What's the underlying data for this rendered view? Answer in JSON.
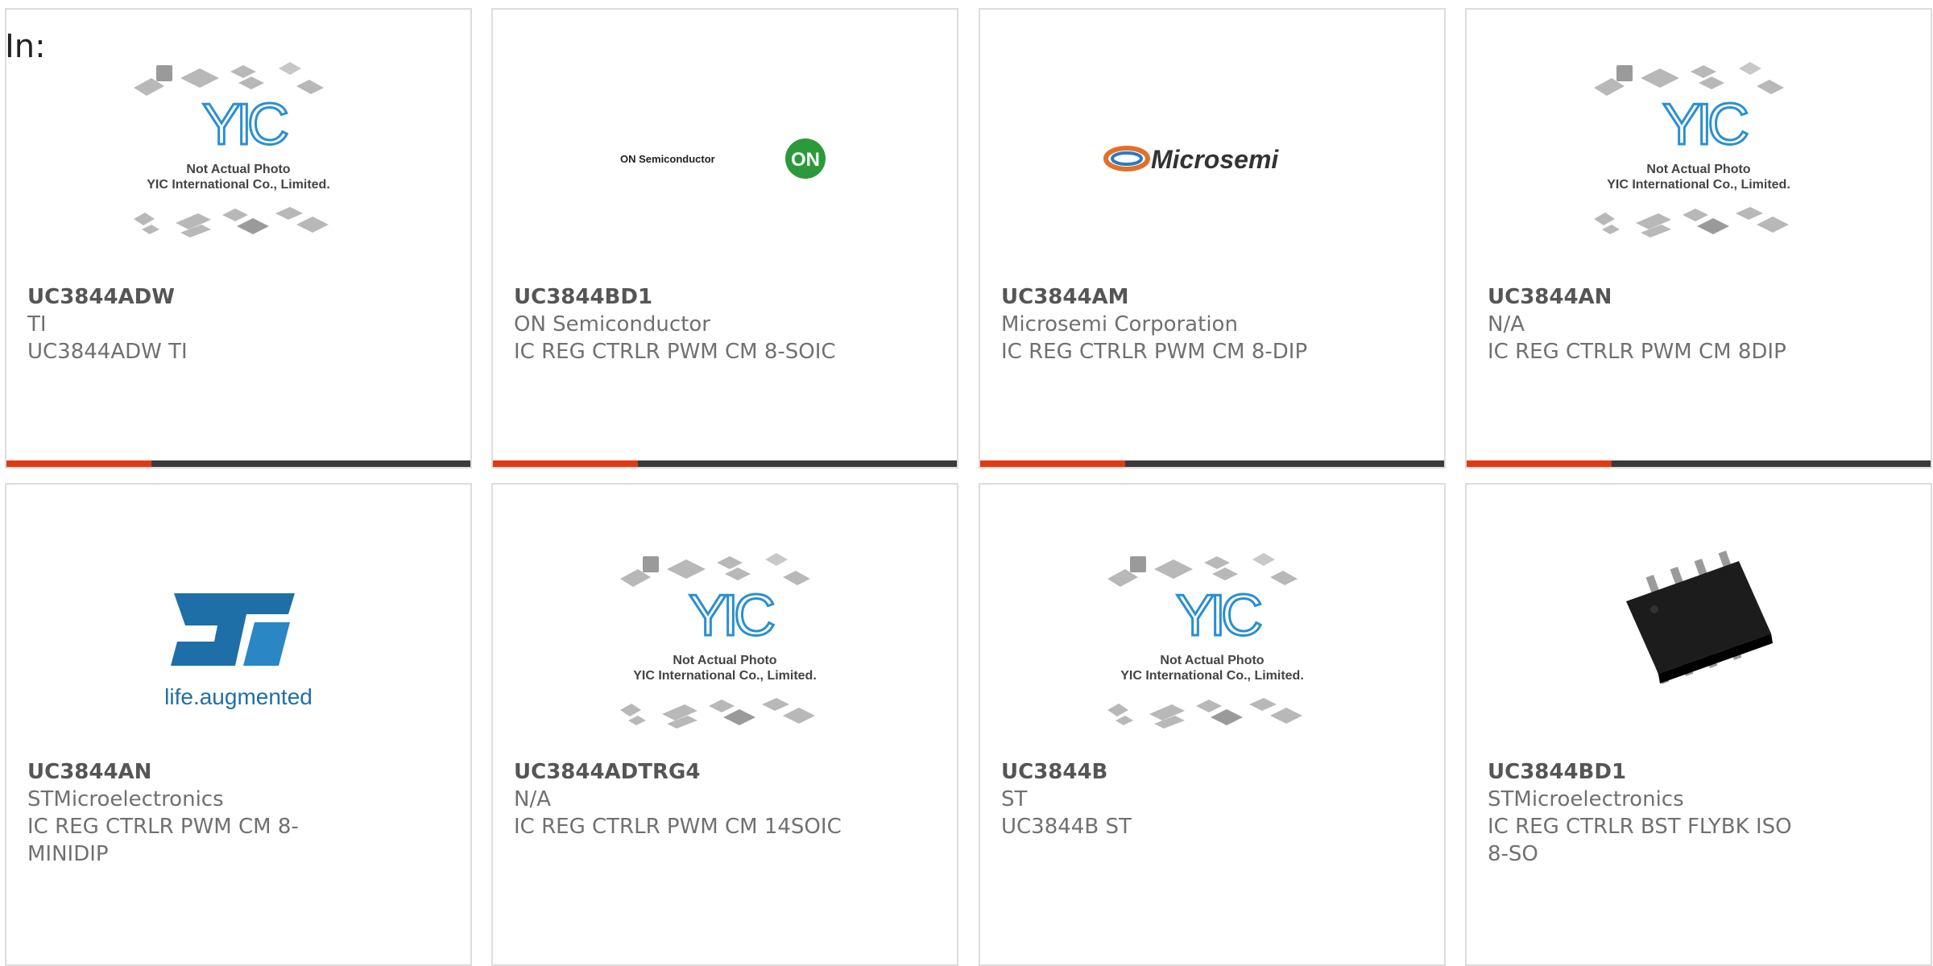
{
  "heading": "In:",
  "placeholder": {
    "line1": "Not Actual Photo",
    "line2": "YIC International Co., Limited.",
    "logo": "YIC"
  },
  "logos": {
    "on": "ON Semiconductor",
    "on_badge": "ON",
    "microsemi": "Microsemi",
    "st_tag": "life.augmented"
  },
  "colors": {
    "accent": "#e03a12",
    "bar": "#3a3a3a",
    "text": "#707070"
  },
  "products": [
    {
      "part": "UC3844ADW",
      "maker": "TI",
      "desc": "UC3844ADW TI",
      "image": "yic-placeholder"
    },
    {
      "part": "UC3844BD1",
      "maker": "ON Semiconductor",
      "desc": "IC REG CTRLR PWM CM 8-SOIC",
      "image": "on-semiconductor-logo"
    },
    {
      "part": "UC3844AM",
      "maker": "Microsemi Corporation",
      "desc": "IC REG CTRLR PWM CM 8-DIP",
      "image": "microsemi-logo"
    },
    {
      "part": "UC3844AN",
      "maker": "N/A",
      "desc": "IC REG CTRLR PWM CM 8DIP",
      "image": "yic-placeholder"
    },
    {
      "part": "UC3844AN",
      "maker": "STMicroelectronics",
      "desc": "IC REG CTRLR PWM CM 8-MINIDIP",
      "image": "st-logo"
    },
    {
      "part": "UC3844ADTRG4",
      "maker": "N/A",
      "desc": "IC REG CTRLR PWM CM 14SOIC",
      "image": "yic-placeholder"
    },
    {
      "part": "UC3844B",
      "maker": "ST",
      "desc": "UC3844B ST",
      "image": "yic-placeholder"
    },
    {
      "part": "UC3844BD1",
      "maker": "STMicroelectronics",
      "desc": "IC REG CTRLR BST FLYBK ISO 8-SO",
      "image": "soic-chip-photo"
    }
  ]
}
